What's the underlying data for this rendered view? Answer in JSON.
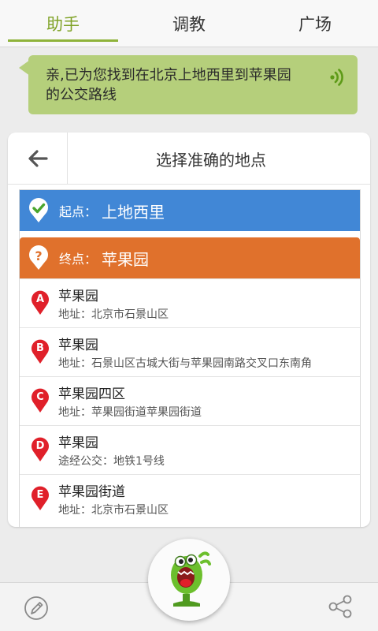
{
  "tabs": [
    {
      "label": "助手",
      "active": true
    },
    {
      "label": "调教",
      "active": false
    },
    {
      "label": "广场",
      "active": false
    }
  ],
  "bubble": {
    "line1": "亲,已为您找到在北京上地西里到苹果园",
    "line2": "的公交路线"
  },
  "card": {
    "title": "选择准确的地点",
    "start": {
      "label": "起点：",
      "value": "上地西里"
    },
    "end": {
      "label": "终点：",
      "value": "苹果园"
    },
    "results": [
      {
        "letter": "A",
        "name": "苹果园",
        "detail": "地址：北京市石景山区"
      },
      {
        "letter": "B",
        "name": "苹果园",
        "detail": "地址：石景山区古城大街与苹果园南路交叉口东南角"
      },
      {
        "letter": "C",
        "name": "苹果园四区",
        "detail": "地址：苹果园街道苹果园街道"
      },
      {
        "letter": "D",
        "name": "苹果园",
        "detail": "途经公交：地铁1号线"
      },
      {
        "letter": "E",
        "name": "苹果园街道",
        "detail": "地址：北京市石景山区"
      }
    ]
  },
  "colors": {
    "accent": "#7fa226",
    "bubble": "#b5cf7b",
    "start_bar": "#4187d6",
    "end_bar": "#e0712c",
    "marker": "#e0202a"
  },
  "icons": {
    "back": "arrow-left-icon",
    "sound": "sound-wave-icon",
    "start_pin": "check-pin-icon",
    "end_pin": "question-pin-icon",
    "pen": "pen-icon",
    "share": "share-icon",
    "mic": "microphone-mascot-icon"
  }
}
